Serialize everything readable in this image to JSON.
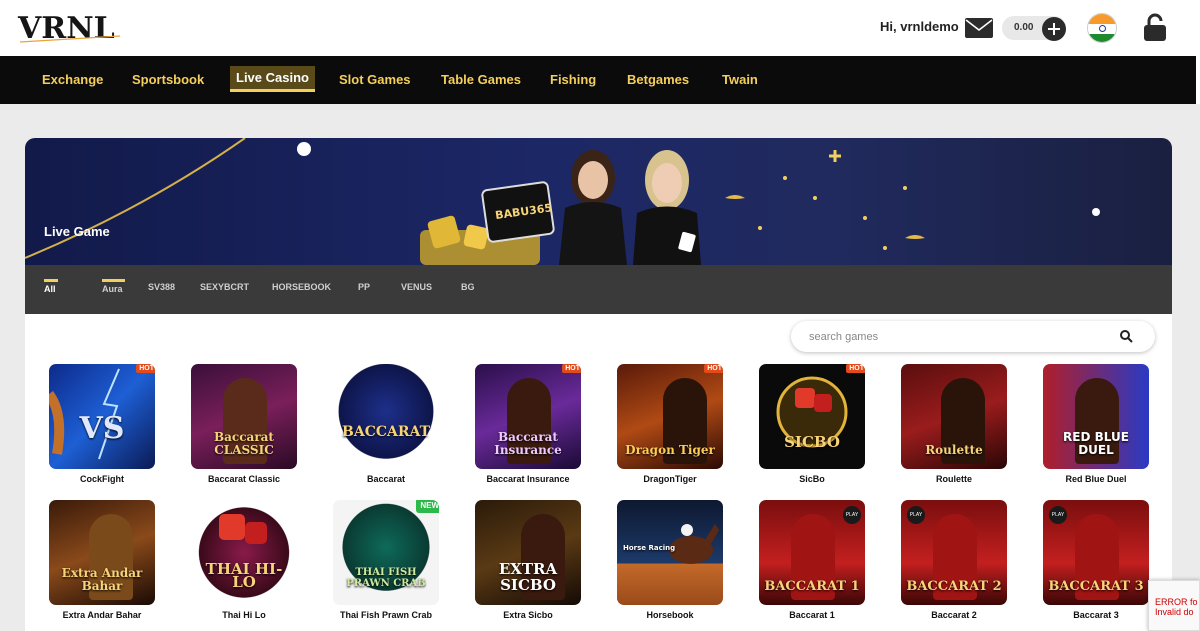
{
  "header": {
    "greeting": "Hi, vrnldemo",
    "balance": "0.00",
    "icons": {
      "mail": "mail-icon",
      "add": "plus-icon",
      "flag": "india-flag-icon",
      "lock": "lock-icon"
    }
  },
  "nav": {
    "items": [
      {
        "label": "Exchange"
      },
      {
        "label": "Sportsbook"
      },
      {
        "label": "Live Casino",
        "active": true
      },
      {
        "label": "Slot Games"
      },
      {
        "label": "Table Games"
      },
      {
        "label": "Fishing"
      },
      {
        "label": "Betgames"
      },
      {
        "label": "Twain"
      }
    ]
  },
  "banner": {
    "title": "Live Game",
    "tablet_text": "BABU365"
  },
  "providers": [
    "All",
    "Aura",
    "SV388",
    "SEXYBCRT",
    "HORSEBOOK",
    "PP",
    "VENUS",
    "BG"
  ],
  "search": {
    "placeholder": "search games"
  },
  "games": [
    {
      "name": "CockFight",
      "tag": "HOT",
      "art": "VS"
    },
    {
      "name": "Baccarat Classic",
      "tag": "",
      "art": "Baccarat CLASSIC"
    },
    {
      "name": "Baccarat",
      "tag": "",
      "art": "BACCARAT"
    },
    {
      "name": "Baccarat Insurance",
      "tag": "HOT",
      "art": "Baccarat Insurance"
    },
    {
      "name": "DragonTiger",
      "tag": "HOT",
      "art": "Dragon Tiger"
    },
    {
      "name": "SicBo",
      "tag": "HOT",
      "art": "SICBO"
    },
    {
      "name": "Roulette",
      "tag": "",
      "art": "Roulette"
    },
    {
      "name": "Red Blue Duel",
      "tag": "",
      "art": "RED BLUE DUEL"
    },
    {
      "name": "Extra Andar Bahar",
      "tag": "",
      "art": "Extra Andar Bahar"
    },
    {
      "name": "Thai Hi Lo",
      "tag": "",
      "art": "THAI HI-LO"
    },
    {
      "name": "Thai Fish Prawn Crab",
      "tag": "NEW",
      "art": "THAI FISH PRAWN CRAB"
    },
    {
      "name": "Extra Sicbo",
      "tag": "",
      "art": "EXTRA SICBO"
    },
    {
      "name": "Horsebook",
      "tag": "",
      "art": "Horse Racing"
    },
    {
      "name": "Baccarat 1",
      "tag": "PLAY",
      "art": "BACCARAT 1"
    },
    {
      "name": "Baccarat 2",
      "tag": "PLAY",
      "art": "BACCARAT 2"
    },
    {
      "name": "Baccarat 3",
      "tag": "PLAY",
      "art": "BACCARAT 3"
    }
  ],
  "recaptcha": {
    "line1": "ERROR fo",
    "line2": "Invalid do"
  }
}
